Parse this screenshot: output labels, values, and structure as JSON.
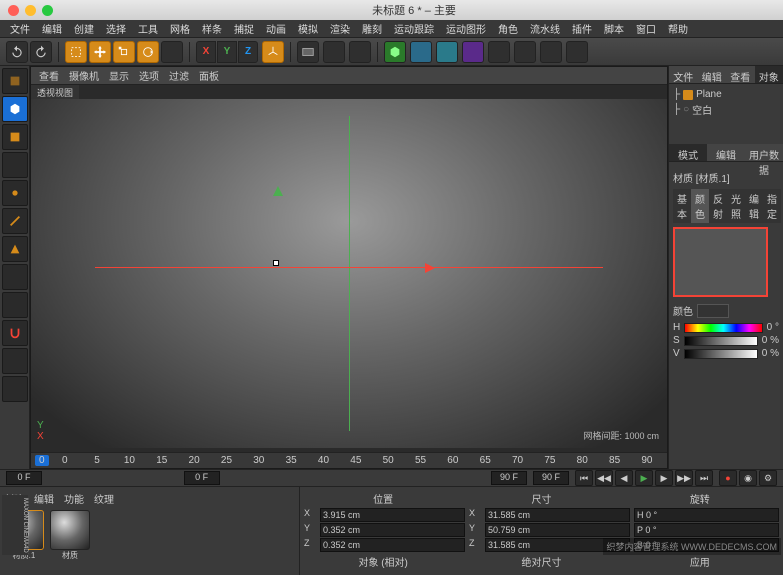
{
  "title": "未标题 6 * – 主要",
  "menus": [
    "文件",
    "编辑",
    "创建",
    "选择",
    "工具",
    "网格",
    "样条",
    "捕捉",
    "动画",
    "模拟",
    "渲染",
    "雕刻",
    "运动跟踪",
    "运动图形",
    "角色",
    "流水线",
    "插件",
    "脚本",
    "窗口",
    "帮助"
  ],
  "viewport_tabs": [
    "查看",
    "摄像机",
    "显示",
    "选项",
    "过滤",
    "面板"
  ],
  "viewport_name": "透视视图",
  "grid_info": "网格间距: 1000 cm",
  "ruler": {
    "start": "0",
    "ticks": [
      "0",
      "5",
      "10",
      "15",
      "20",
      "25",
      "30",
      "35",
      "40",
      "45",
      "50",
      "55",
      "60",
      "65",
      "70",
      "75",
      "80",
      "85",
      "90"
    ],
    "end": "90"
  },
  "timeline": {
    "startF": "0 F",
    "currentF": "0 F",
    "endF": "90 F",
    "endF2": "90 F"
  },
  "right": {
    "tabs_top": [
      "文件",
      "编辑",
      "查看",
      "对象"
    ],
    "objects": [
      {
        "name": "Plane"
      }
    ],
    "sel_item": "空白",
    "attr_tabs": [
      "模式",
      "编辑",
      "用户数据"
    ],
    "material_title": "材质 [材质.1]",
    "attr_subtabs": [
      "基本",
      "颜色",
      "反射",
      "光照",
      "编辑",
      "指定"
    ],
    "color_label": "颜色",
    "hsv": [
      {
        "k": "H",
        "v": "0 °"
      },
      {
        "k": "S",
        "v": "0 %"
      },
      {
        "k": "V",
        "v": "0 %"
      }
    ]
  },
  "materials": {
    "tabs": [
      "创建",
      "编辑",
      "功能",
      "纹理"
    ],
    "items": [
      {
        "label": "材质.1"
      },
      {
        "label": "材质"
      }
    ]
  },
  "coords": {
    "headers": [
      "位置",
      "尺寸",
      "旋转"
    ],
    "rows": [
      {
        "axis": "X",
        "p": "3.915 cm",
        "s": "31.585 cm",
        "r": "H 0 °"
      },
      {
        "axis": "Y",
        "p": "0.352 cm",
        "s": "50.759 cm",
        "r": "P 0 °"
      },
      {
        "axis": "Z",
        "p": "0.352 cm",
        "s": "31.585 cm",
        "r": "B 0 °"
      }
    ],
    "footer": [
      "对象 (相对)",
      "绝对尺寸",
      "应用"
    ]
  },
  "logo": "MAXON CINEMA4D",
  "watermark": "织梦内容管理系统\nWWW.DEDECMS.COM"
}
